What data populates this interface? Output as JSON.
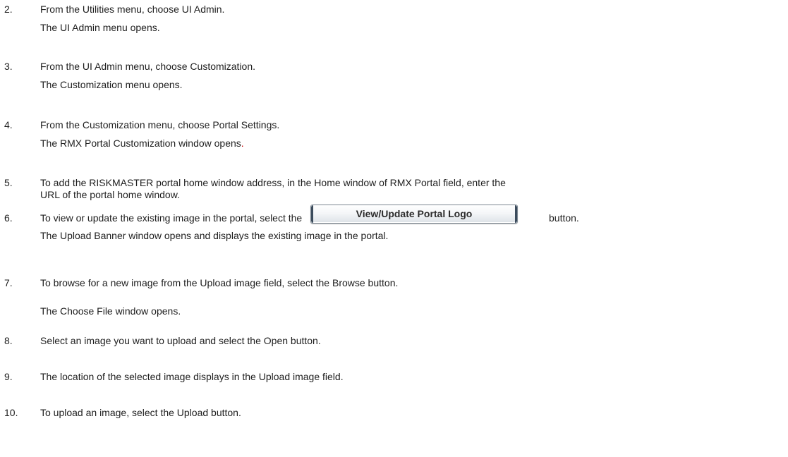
{
  "steps": [
    {
      "number": "2.",
      "text": "From the Utilities menu, choose UI Admin.",
      "result": "The UI Admin menu opens."
    },
    {
      "number": "3.",
      "text": "From the UI Admin menu, choose Customization.",
      "result": "The Customization menu opens."
    },
    {
      "number": "4.",
      "text": "From the Customization menu, choose Portal Settings.",
      "result": "The RMX Portal Customization window opens",
      "result_end": "."
    },
    {
      "number": "5.",
      "text": "To add the RISKMASTER portal home window address, in the Home window of RMX Portal field, enter the",
      "text_cont": "URL of the portal home window."
    },
    {
      "number": "6.",
      "text": "To view or update the existing image in the portal, select the",
      "button_label": "View/Update Portal Logo",
      "text_after": "button.",
      "result": "The Upload Banner window opens and displays the existing image in the portal."
    },
    {
      "number": "7.",
      "text": "To browse for a new image from the Upload image field, select the Browse button.",
      "result": "The Choose File window opens."
    },
    {
      "number": "8.",
      "text": "Select an image you want to upload and select the Open button."
    },
    {
      "number": "9.",
      "text": "The location of the selected image displays in the Upload image field."
    },
    {
      "number": "10.",
      "text": "To upload an image, select the Upload button."
    }
  ],
  "colors": {
    "text": "#1e1e1e",
    "accent_period": "#cc0000"
  }
}
